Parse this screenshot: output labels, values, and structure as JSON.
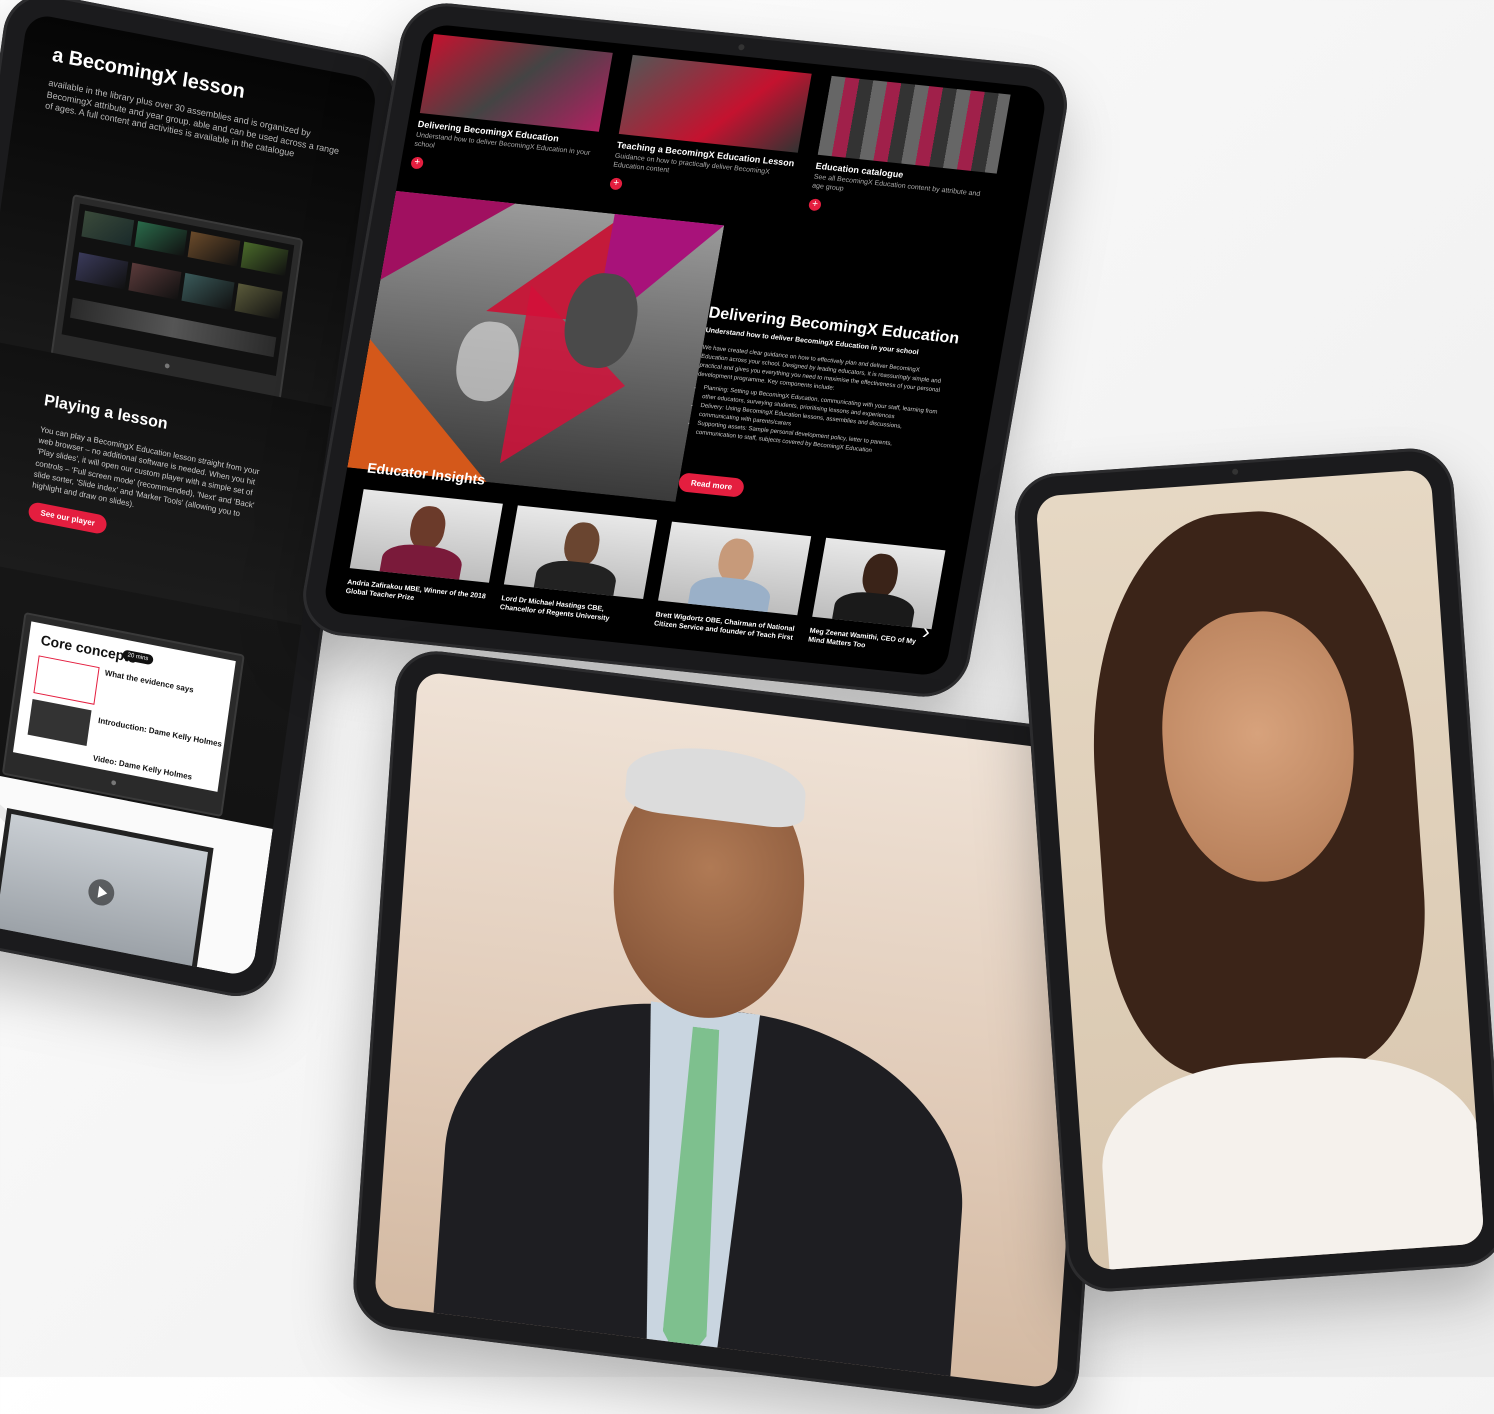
{
  "left_tablet": {
    "title": "a BecomingX lesson",
    "intro": "available in the library plus over 30 assemblies and is organized by BecomingX attribute and year group. able and can be used across a range of ages. A full content and activities is available in the catalogue",
    "playing_title": "Playing a lesson",
    "playing_body": "You can play a BecomingX Education lesson straight from your web browser – no additional software is needed. When you hit 'Play slides', it will open our custom player with a simple set of controls – 'Full screen mode' (recommended), 'Next' and 'Back' slide sorter, 'Slide index' and 'Marker Tools' (allowing you to highlight and draw on slides).",
    "player_button": "See our player",
    "core_title": "Core concepts",
    "core_badge": "20 mins",
    "evidence_heading": "What the evidence says",
    "intro_heading": "Introduction: Dame Kelly Holmes",
    "video_heading": "Video: Dame Kelly Holmes"
  },
  "top_tablet": {
    "cards": [
      {
        "title": "Delivering BecomingX Education",
        "subtitle": "Understand how to deliver BecomingX Education in your school",
        "plus": "+"
      },
      {
        "title": "Teaching a BecomingX Education Lesson",
        "subtitle": "Guidance on how to practically deliver BecomingX Education content",
        "plus": "+"
      },
      {
        "title": "Education catalogue",
        "subtitle": "See all BecomingX Education content by attribute and age group",
        "plus": "+"
      }
    ],
    "hero": {
      "title": "Delivering BecomingX Education",
      "subtitle": "Understand how to deliver BecomingX Education in your school",
      "body": "We have created clear guidance on how to effectively plan and deliver BecomingX Education across your school. Designed by leading educators, it is reassuringly simple and practical and gives you everything you need to maximise the effectiveness of your personal development programme. Key components include:",
      "bullets": [
        "Planning: Setting up BecomingX Education, communicating with your staff, learning from other educators, surveying students, prioritising lessons and experiences",
        "Delivery: Using BecomingX Education lessons, assemblies and discussions, communicating with parents/carers",
        "Supporting assets: Sample personal development policy, letter to parents, communication to staff, subjects covered by BecomingX Education"
      ],
      "button": "Read more"
    },
    "insights_title": "Educator Insights",
    "insights": [
      "Andria Zafirakou MBE, Winner of the 2018 Global Teacher Prize",
      "Lord Dr Michael Hastings CBE, Chancellor of Regents University",
      "Brett Wigdortz OBE, Chairman of National Citizen Service and founder of Teach First",
      "Meg Zeenat Wamithi, CEO of My Mind Matters Too"
    ]
  },
  "colors": {
    "accent": "#e41e3f",
    "dark": "#000000"
  },
  "icons": [
    "plus-icon",
    "chevron-right-icon",
    "play-icon",
    "apple-logo-icon"
  ]
}
